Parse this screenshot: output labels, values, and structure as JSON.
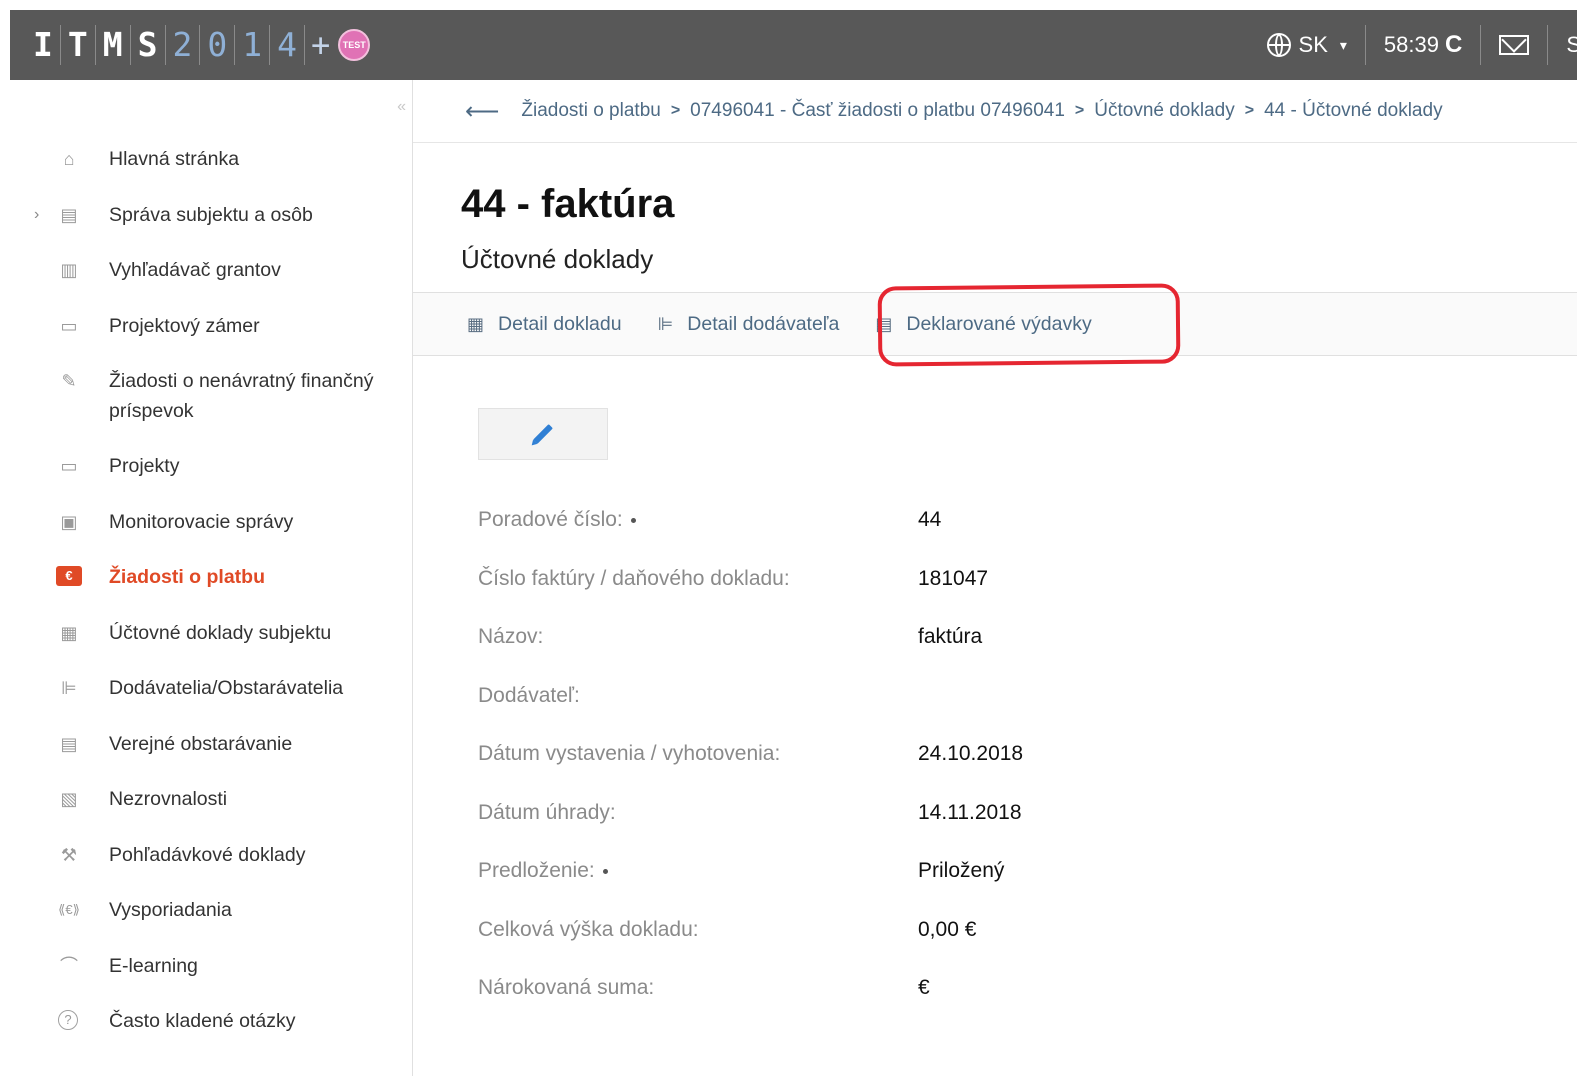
{
  "app": {
    "logo_letters": [
      "I",
      "T",
      "M",
      "S"
    ],
    "logo_digits": [
      "2",
      "0",
      "1",
      "4"
    ],
    "logo_plus": "+",
    "test_badge": "TEST",
    "language": "SK",
    "session_timer": "58:39",
    "refresh_glyph": "C",
    "user_cut": "S"
  },
  "sidebar": {
    "collapse_glyph": "«",
    "items": [
      {
        "label": "Hlavná stránka",
        "icon": "home-icon",
        "glyph": "⌂"
      },
      {
        "label": "Správa subjektu a osôb",
        "icon": "id-card-icon",
        "glyph": "▤"
      },
      {
        "label": "Vyhľadávač grantov",
        "icon": "document-search-icon",
        "glyph": "▥"
      },
      {
        "label": "Projektový zámer",
        "icon": "archive-icon",
        "glyph": "▭"
      },
      {
        "label": "Žiadosti o nenávratný finančný príspevok",
        "icon": "edit-form-icon",
        "glyph": "✎"
      },
      {
        "label": "Projekty",
        "icon": "archive-icon",
        "glyph": "▭"
      },
      {
        "label": "Monitorovacie správy",
        "icon": "clipboard-icon",
        "glyph": "▣"
      },
      {
        "label": "Žiadosti o platbu",
        "icon": "payment-request-icon",
        "glyph": "€"
      },
      {
        "label": "Účtovné doklady subjektu",
        "icon": "calculator-icon",
        "glyph": "▦"
      },
      {
        "label": "Dodávatelia/Obstarávatelia",
        "icon": "supplier-icon",
        "glyph": "⊫"
      },
      {
        "label": "Verejné obstarávanie",
        "icon": "procurement-icon",
        "glyph": "▤"
      },
      {
        "label": "Nezrovnalosti",
        "icon": "chart-box-icon",
        "glyph": "▧"
      },
      {
        "label": "Pohľadávkové doklady",
        "icon": "gavel-icon",
        "glyph": "⚒"
      },
      {
        "label": "Vysporiadania",
        "icon": "euro-exchange-icon",
        "glyph": "⟪€⟫"
      },
      {
        "label": "E-learning",
        "icon": "graduation-cap-icon",
        "glyph": "⌒"
      },
      {
        "label": "Často kladené otázky",
        "icon": "question-circle-icon",
        "glyph": "?"
      }
    ]
  },
  "breadcrumb": {
    "items": [
      "Žiadosti o platbu",
      "07496041 - Časť žiadosti o platbu 07496041",
      "Účtovné doklady",
      "44 - Účtovné doklady"
    ]
  },
  "page": {
    "title": "44 - faktúra",
    "subtitle": "Účtovné doklady"
  },
  "tabs": [
    {
      "label": "Detail dokladu",
      "icon": "calculator-icon"
    },
    {
      "label": "Detail dodávateľa",
      "icon": "supplier-icon"
    },
    {
      "label": "Deklarované výdavky",
      "icon": "document-list-icon"
    }
  ],
  "fields": [
    {
      "label": "Poradové číslo:",
      "value": "44",
      "required": true
    },
    {
      "label": "Číslo faktúry / daňového dokladu:",
      "value": "181047",
      "required": false
    },
    {
      "label": "Názov:",
      "value": "faktúra",
      "required": false
    },
    {
      "label": "Dodávateľ:",
      "value": "",
      "required": false
    },
    {
      "label": "Dátum vystavenia / vyhotovenia:",
      "value": "24.10.2018",
      "required": false
    },
    {
      "label": "Dátum úhrady:",
      "value": "14.11.2018",
      "required": false
    },
    {
      "label": "Predloženie:",
      "value": "Priložený",
      "required": true
    },
    {
      "label": "Celková výška dokladu:",
      "value": "0,00 €",
      "required": false
    },
    {
      "label": "Nárokovaná suma:",
      "value": "€",
      "required": false
    }
  ],
  "colors": {
    "topbar": "#585858",
    "accent_active": "#e04a26",
    "link": "#4d6a84",
    "highlight": "#e52631"
  }
}
